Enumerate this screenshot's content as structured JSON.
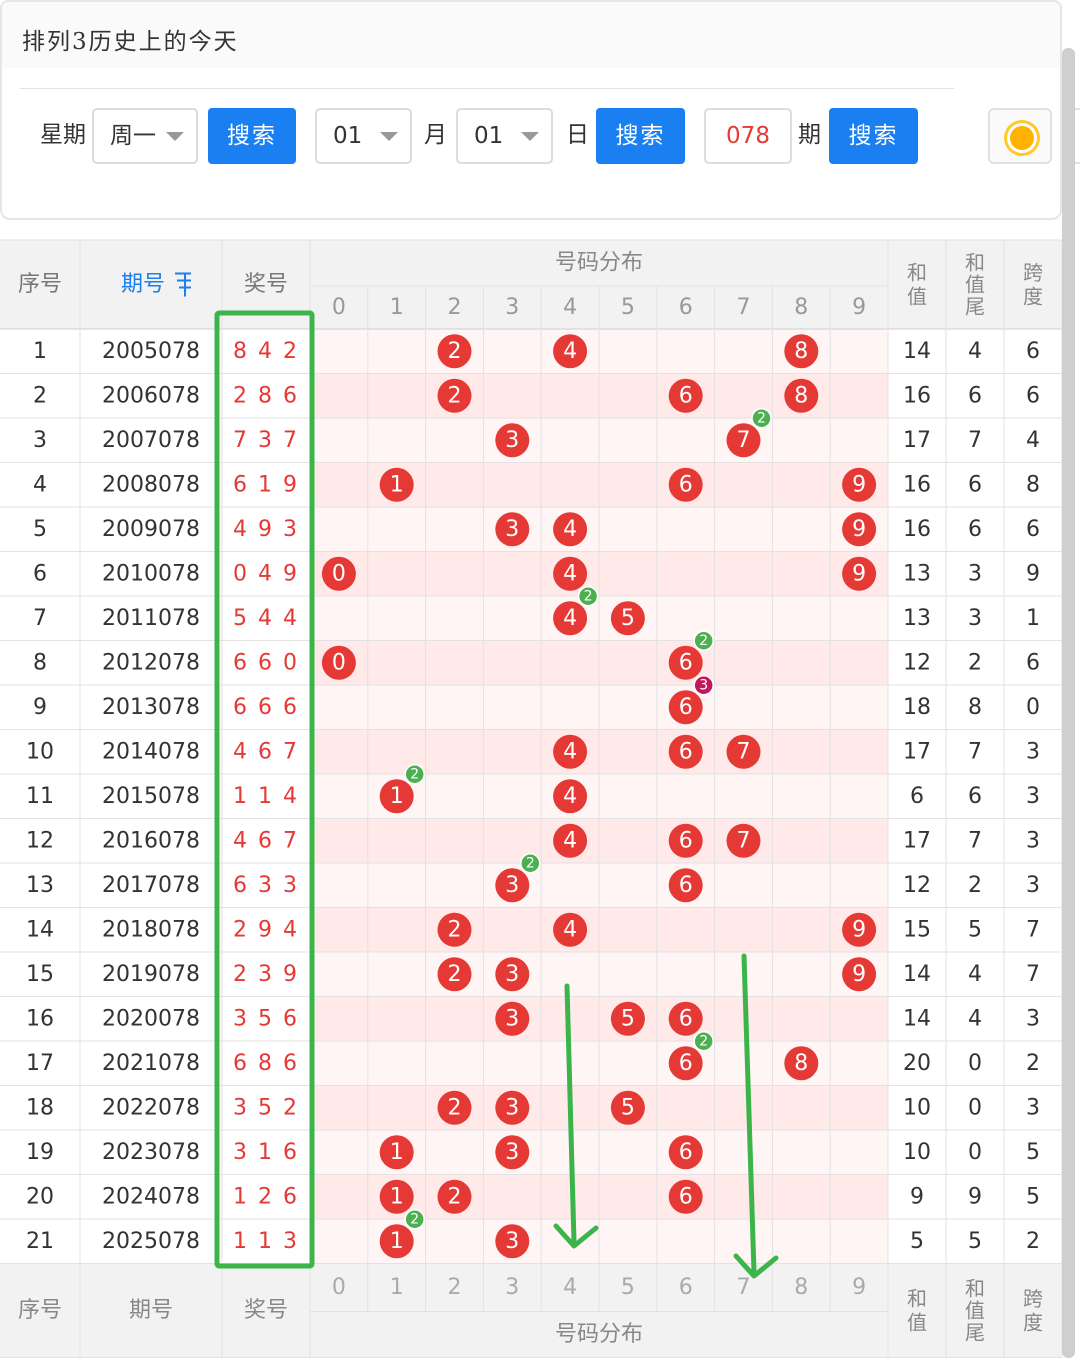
{
  "page": {
    "title": "排列3历史上的今天"
  },
  "filters": {
    "weekday_label": "星期",
    "weekday_value": "周一",
    "search1": "搜索",
    "month_value": "01",
    "month_label": "月",
    "day_value": "01",
    "day_label": "日",
    "search2": "搜索",
    "issue_value": "078",
    "issue_label": "期",
    "search3": "搜索",
    "theme_icon": "sun-icon"
  },
  "table": {
    "headers": {
      "seq": "序号",
      "issue": "期号",
      "prize": "奖号",
      "dist": "号码分布",
      "sum": "和值",
      "sum_tail": "和值尾",
      "span": "跨度"
    },
    "sort_icon": "sort-icon",
    "digits": [
      "0",
      "1",
      "2",
      "3",
      "4",
      "5",
      "6",
      "7",
      "8",
      "9"
    ],
    "rows": [
      {
        "seq": "1",
        "issue": "2005078",
        "prize": "8 4 2",
        "sum": "14",
        "tail": "4",
        "span": "6"
      },
      {
        "seq": "2",
        "issue": "2006078",
        "prize": "2 8 6",
        "sum": "16",
        "tail": "6",
        "span": "6"
      },
      {
        "seq": "3",
        "issue": "2007078",
        "prize": "7 3 7",
        "sum": "17",
        "tail": "7",
        "span": "4"
      },
      {
        "seq": "4",
        "issue": "2008078",
        "prize": "6 1 9",
        "sum": "16",
        "tail": "6",
        "span": "8"
      },
      {
        "seq": "5",
        "issue": "2009078",
        "prize": "4 9 3",
        "sum": "16",
        "tail": "6",
        "span": "6"
      },
      {
        "seq": "6",
        "issue": "2010078",
        "prize": "0 4 9",
        "sum": "13",
        "tail": "3",
        "span": "9"
      },
      {
        "seq": "7",
        "issue": "2011078",
        "prize": "5 4 4",
        "sum": "13",
        "tail": "3",
        "span": "1"
      },
      {
        "seq": "8",
        "issue": "2012078",
        "prize": "6 6 0",
        "sum": "12",
        "tail": "2",
        "span": "6"
      },
      {
        "seq": "9",
        "issue": "2013078",
        "prize": "6 6 6",
        "sum": "18",
        "tail": "8",
        "span": "0"
      },
      {
        "seq": "10",
        "issue": "2014078",
        "prize": "4 6 7",
        "sum": "17",
        "tail": "7",
        "span": "3"
      },
      {
        "seq": "11",
        "issue": "2015078",
        "prize": "1 1 4",
        "sum": "6",
        "tail": "6",
        "span": "3"
      },
      {
        "seq": "12",
        "issue": "2016078",
        "prize": "4 6 7",
        "sum": "17",
        "tail": "7",
        "span": "3"
      },
      {
        "seq": "13",
        "issue": "2017078",
        "prize": "6 3 3",
        "sum": "12",
        "tail": "2",
        "span": "3"
      },
      {
        "seq": "14",
        "issue": "2018078",
        "prize": "2 9 4",
        "sum": "15",
        "tail": "5",
        "span": "7"
      },
      {
        "seq": "15",
        "issue": "2019078",
        "prize": "2 3 9",
        "sum": "14",
        "tail": "4",
        "span": "7"
      },
      {
        "seq": "16",
        "issue": "2020078",
        "prize": "3 5 6",
        "sum": "14",
        "tail": "4",
        "span": "3"
      },
      {
        "seq": "17",
        "issue": "2021078",
        "prize": "6 8 6",
        "sum": "20",
        "tail": "0",
        "span": "2"
      },
      {
        "seq": "18",
        "issue": "2022078",
        "prize": "3 5 2",
        "sum": "10",
        "tail": "0",
        "span": "3"
      },
      {
        "seq": "19",
        "issue": "2023078",
        "prize": "3 1 6",
        "sum": "10",
        "tail": "0",
        "span": "5"
      },
      {
        "seq": "20",
        "issue": "2024078",
        "prize": "1 2 6",
        "sum": "9",
        "tail": "9",
        "span": "5"
      },
      {
        "seq": "21",
        "issue": "2025078",
        "prize": "1 1 3",
        "sum": "5",
        "tail": "5",
        "span": "2"
      }
    ]
  },
  "colors": {
    "ball": "#e53935",
    "ball_count2": "#4caf50",
    "ball_count3": "#c2185b",
    "annotation": "#3bb54a",
    "link": "#1a7ff0",
    "prize_text": "#e53935"
  }
}
